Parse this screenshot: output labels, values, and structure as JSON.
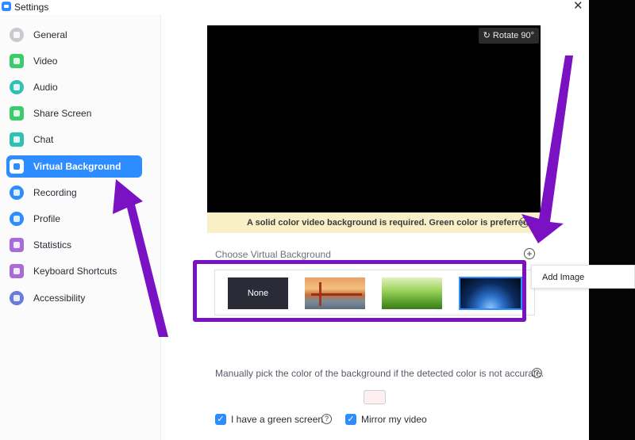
{
  "window": {
    "title": "Settings",
    "close_glyph": "✕"
  },
  "sidebar": {
    "items": [
      {
        "label": "General",
        "icon": "gear-icon",
        "color": "#c9c9cf",
        "active": false
      },
      {
        "label": "Video",
        "icon": "video-camera-icon",
        "color": "#3ecb6b",
        "active": false
      },
      {
        "label": "Audio",
        "icon": "headphones-icon",
        "color": "#30c0b4",
        "active": false
      },
      {
        "label": "Share Screen",
        "icon": "share-screen-icon",
        "color": "#3ecb6b",
        "active": false
      },
      {
        "label": "Chat",
        "icon": "chat-bubble-icon",
        "color": "#30c0b4",
        "active": false
      },
      {
        "label": "Virtual Background",
        "icon": "virtual-background-icon",
        "color": "#2d8cff",
        "active": true
      },
      {
        "label": "Recording",
        "icon": "recording-icon",
        "color": "#2d8cff",
        "active": false
      },
      {
        "label": "Profile",
        "icon": "profile-icon",
        "color": "#2d8cff",
        "active": false
      },
      {
        "label": "Statistics",
        "icon": "statistics-icon",
        "color": "#a86bd8",
        "active": false
      },
      {
        "label": "Keyboard Shortcuts",
        "icon": "keyboard-icon",
        "color": "#a86bd8",
        "active": false
      },
      {
        "label": "Accessibility",
        "icon": "accessibility-icon",
        "color": "#6a7bd8",
        "active": false
      }
    ]
  },
  "preview": {
    "rotate_label": "Rotate 90°",
    "warning": "A solid color video background is required. Green color is preferred."
  },
  "backgrounds": {
    "section_label": "Choose Virtual Background",
    "add_tooltip": "Add Image",
    "none_label": "None",
    "thumbnails": [
      "none",
      "golden-gate-bridge",
      "grass",
      "earth-from-space"
    ],
    "selected": "earth-from-space"
  },
  "manual": {
    "text": "Manually pick the color of the background if the detected color is not accurate.",
    "swatch_color": "#fdeef2"
  },
  "options": {
    "green_screen_label": "I have a green screen",
    "green_screen_checked": true,
    "mirror_label": "Mirror my video",
    "mirror_checked": true
  },
  "annotation_color": "#7a12c4"
}
